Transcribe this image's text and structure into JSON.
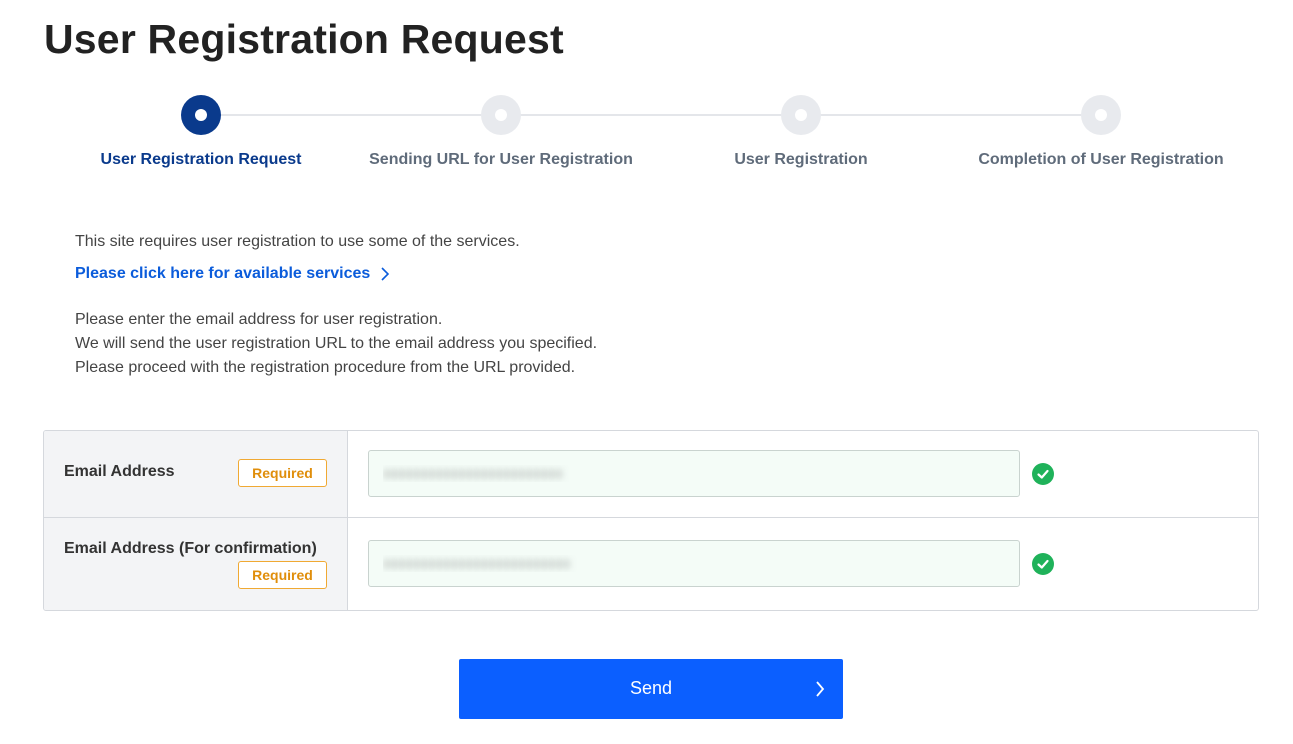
{
  "page": {
    "title": "User Registration Request"
  },
  "stepper": {
    "steps": [
      {
        "label": "User Registration Request",
        "state": "active"
      },
      {
        "label": "Sending URL for User Registration",
        "state": "inactive"
      },
      {
        "label": "User Registration",
        "state": "inactive"
      },
      {
        "label": "Completion of User Registration",
        "state": "inactive"
      }
    ]
  },
  "intro": {
    "notice": "This site requires user registration to use some of the services.",
    "services_link": "Please click here for available services",
    "instructions": [
      "Please enter the email address for user registration.",
      "We will send the user registration URL to the email address you specified.",
      "Please proceed with the registration procedure from the URL provided."
    ]
  },
  "form": {
    "email": {
      "label": "Email Address",
      "badge": "Required",
      "value": "xxxxxxxxxxxxxxxxxxxxxxxx",
      "valid": true
    },
    "email_confirm": {
      "label": "Email Address (For confirmation)",
      "badge": "Required",
      "value": "xxxxxxxxxxxxxxxxxxxxxxxxx",
      "valid": true
    }
  },
  "actions": {
    "send_label": "Send"
  },
  "colors": {
    "accent": "#0b5fff",
    "active_step": "#0a3a8c",
    "link": "#0b5cdb",
    "required_badge": "#f0a933",
    "valid_check": "#1fb25a"
  },
  "icons": {
    "link_chevron": "chevron-right-icon",
    "valid": "check-circle-icon",
    "send_chevron": "chevron-right-icon"
  }
}
